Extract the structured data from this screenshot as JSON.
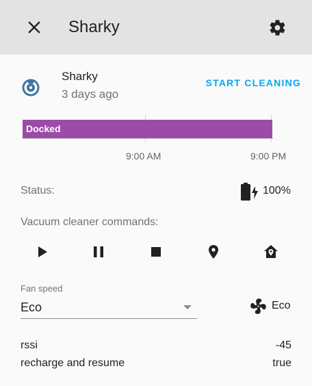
{
  "header": {
    "title": "Sharky",
    "close_icon": "close-icon",
    "settings_icon": "gear-icon"
  },
  "entity": {
    "name": "Sharky",
    "last_changed": "3 days ago",
    "icon": "robot-vacuum-icon",
    "action_label": "START CLEANING",
    "accent_color": "#03a9f4"
  },
  "timeline": {
    "state_label": "Docked",
    "state_color": "#9b4ca6",
    "ticks": [
      "9:00 AM",
      "9:00 PM"
    ]
  },
  "status": {
    "label": "Status:",
    "battery_icon": "battery-charging-icon",
    "battery_level": "100%"
  },
  "commands": {
    "label": "Vacuum cleaner commands:",
    "items": [
      "play-icon",
      "pause-icon",
      "stop-icon",
      "locate-icon",
      "return-home-icon"
    ]
  },
  "fan_speed": {
    "label": "Fan speed",
    "selected": "Eco",
    "icon": "fan-icon",
    "current": "Eco"
  },
  "attributes": [
    {
      "name": "rssi",
      "value": "-45"
    },
    {
      "name": "recharge and resume",
      "value": "true"
    }
  ]
}
